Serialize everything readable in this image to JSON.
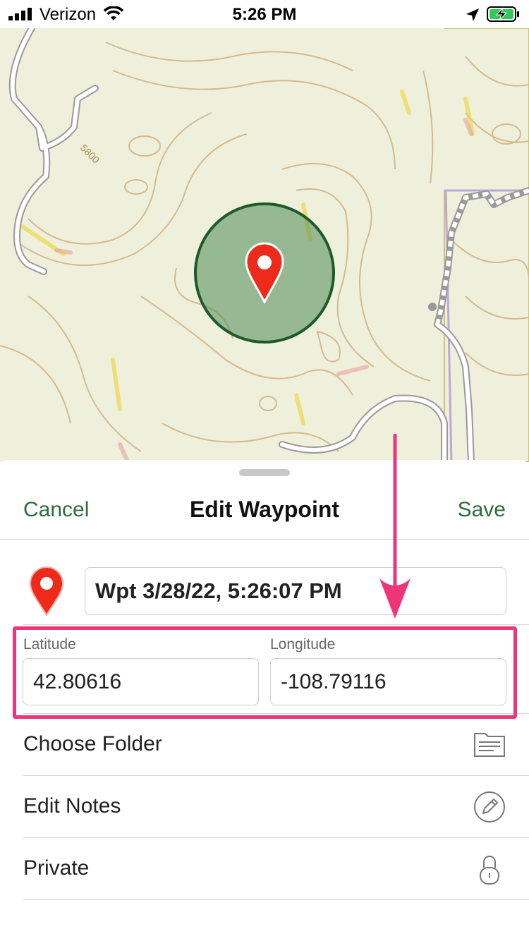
{
  "status_bar": {
    "carrier": "Verizon",
    "time": "5:26 PM"
  },
  "map": {
    "contour_label": "5800",
    "colors": {
      "background": "#eef0dc",
      "contour": "#d8b98a",
      "road": "#ffffff",
      "radius_fill": "#4f8a55",
      "radius_stroke": "#1f5a2a",
      "pin": "#ee2a1a"
    }
  },
  "sheet": {
    "cancel_label": "Cancel",
    "title": "Edit Waypoint",
    "save_label": "Save",
    "waypoint_name": "Wpt 3/28/22, 5:26:07 PM",
    "latitude_label": "Latitude",
    "latitude_value": "42.80616",
    "longitude_label": "Longitude",
    "longitude_value": "-108.79116",
    "rows": [
      {
        "label": "Choose Folder",
        "icon": "folder-icon"
      },
      {
        "label": "Edit Notes",
        "icon": "pencil-icon"
      },
      {
        "label": "Private",
        "icon": "lock-icon"
      }
    ]
  },
  "annotation": {
    "color": "#f0347a"
  }
}
